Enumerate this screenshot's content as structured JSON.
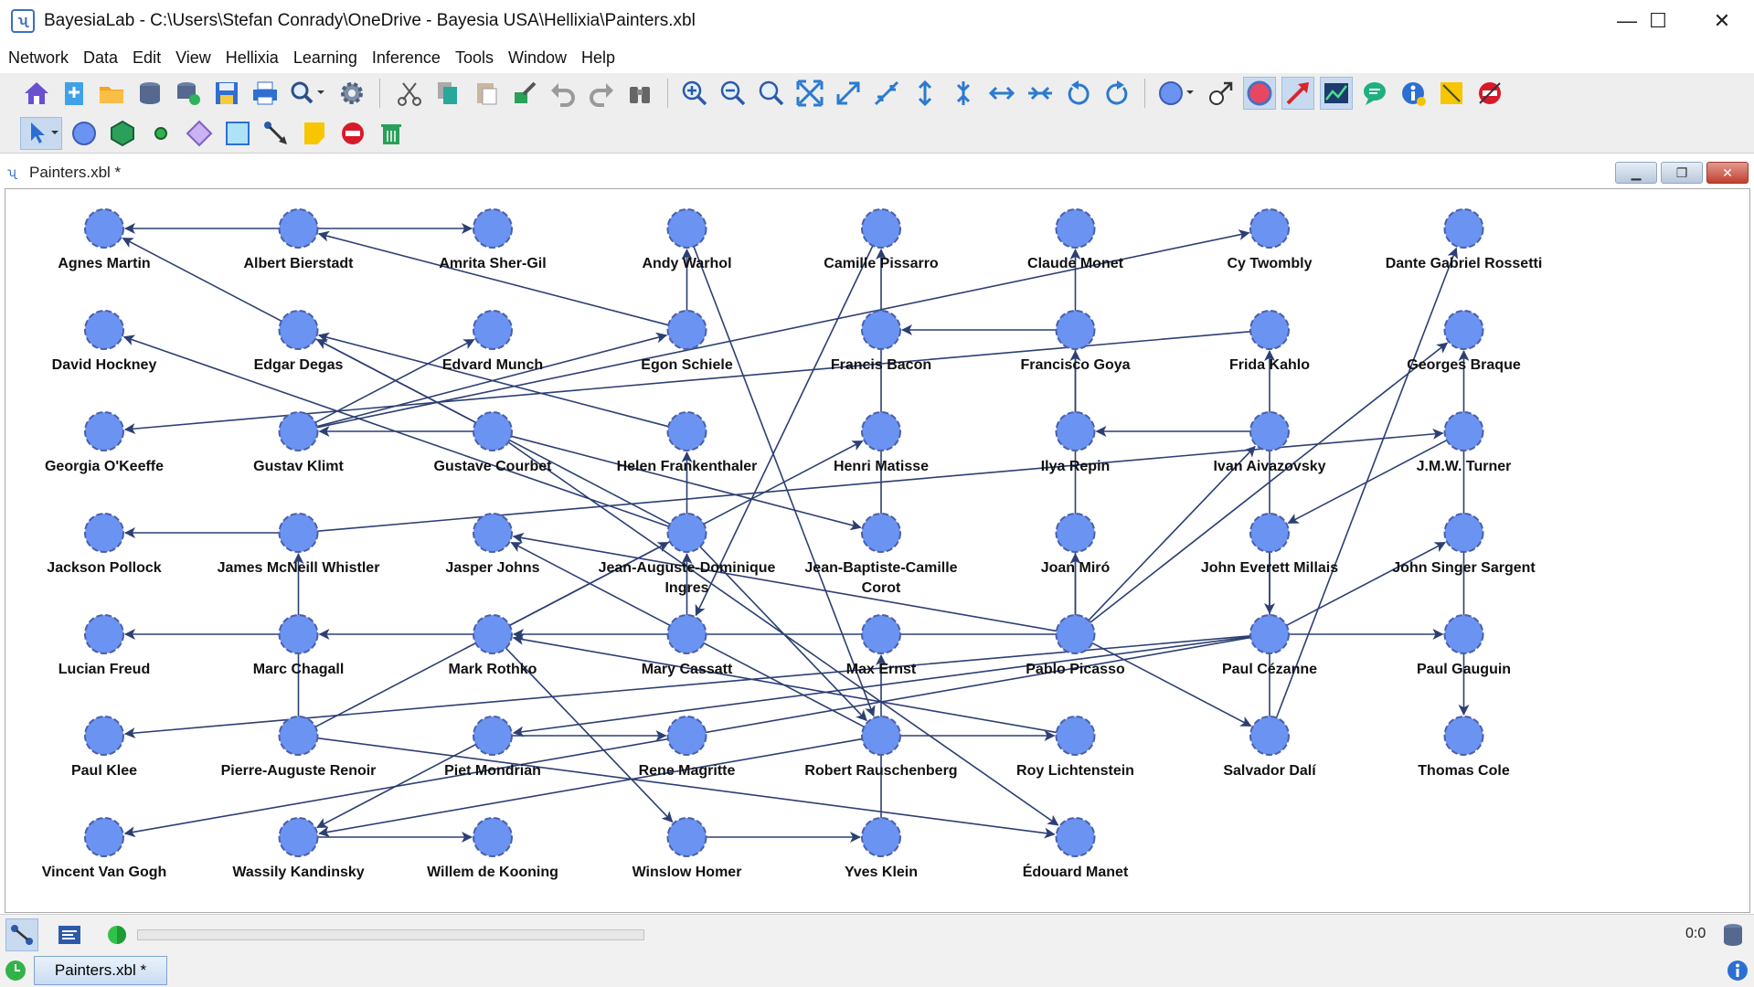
{
  "window": {
    "title": "BayesiaLab - C:\\Users\\Stefan Conrady\\OneDrive - Bayesia USA\\Hellixia\\Painters.xbl",
    "minimize": "—",
    "maximize": "☐",
    "close": "✕"
  },
  "menu": [
    "Network",
    "Data",
    "Edit",
    "View",
    "Hellixia",
    "Learning",
    "Inference",
    "Tools",
    "Window",
    "Help"
  ],
  "toolbar1_icons": [
    "home-icon",
    "new-network-icon",
    "open-folder-icon",
    "database-icon",
    "database-refresh-icon",
    "save-icon",
    "print-icon",
    "search-icon",
    "settings-icon",
    "cut-icon",
    "copy-icon",
    "paste-icon",
    "format-painter-icon",
    "undo-icon",
    "redo-icon",
    "binoculars-icon",
    "zoom-in-icon",
    "zoom-out-icon",
    "zoom-fit-icon",
    "expand-icon",
    "expand-diagonal-icon",
    "shrink-diagonal-icon",
    "expand-vertical-icon",
    "shrink-vertical-icon",
    "expand-horizontal-icon",
    "shrink-horizontal-icon",
    "rotate-left-icon",
    "rotate-right-icon",
    "node-style-icon",
    "layout-arrow-icon",
    "node-mode-icon",
    "arc-mode-icon",
    "chart-icon",
    "comment-icon",
    "info-icon",
    "note-icon",
    "forbidden-icon"
  ],
  "toolbar2_icons": [
    "select-arrow-icon",
    "add-node-icon",
    "add-hexagon-icon",
    "add-point-icon",
    "add-diamond-icon",
    "add-square-icon",
    "add-arc-icon",
    "add-note-icon",
    "forbid-arc-icon",
    "delete-icon"
  ],
  "document": {
    "title": "Painters.xbl *",
    "minimize": "▁",
    "restore": "❐",
    "close": "✕"
  },
  "status": {
    "zoom_readout": "0:0"
  },
  "tab": {
    "label": "Painters.xbl *"
  },
  "colors": {
    "node_fill": "#6b93f2",
    "node_stroke": "#4a5fa8",
    "edge": "#2c3f73"
  },
  "graph": {
    "nodes": [
      "Agnes Martin",
      "Albert Bierstadt",
      "Amrita Sher-Gil",
      "Andy Warhol",
      "Camille Pissarro",
      "Claude Monet",
      "Cy Twombly",
      "Dante Gabriel Rossetti",
      "David Hockney",
      "Edgar Degas",
      "Edvard Munch",
      "Egon Schiele",
      "Francis Bacon",
      "Francisco Goya",
      "Frida Kahlo",
      "Georges Braque",
      "Georgia O'Keeffe",
      "Gustav Klimt",
      "Gustave Courbet",
      "Helen Frankenthaler",
      "Henri Matisse",
      "Ilya Repin",
      "Ivan Aivazovsky",
      "J.M.W. Turner",
      "Jackson Pollock",
      "James McNeill Whistler",
      "Jasper Johns",
      "Jean-Auguste-Dominique Ingres",
      "Jean-Baptiste-Camille Corot",
      "Joan Miró",
      "John Everett Millais",
      "John Singer Sargent",
      "Lucian Freud",
      "Marc Chagall",
      "Mark Rothko",
      "Mary Cassatt",
      "Max Ernst",
      "Pablo Picasso",
      "Paul Cézanne",
      "Paul Gauguin",
      "Paul Klee",
      "Pierre-Auguste Renoir",
      "Piet Mondrian",
      "Rene Magritte",
      "Robert Rauschenberg",
      "Roy Lichtenstein",
      "Salvador Dalí",
      "Thomas Cole",
      "Vincent Van Gogh",
      "Wassily Kandinsky",
      "Willem de Kooning",
      "Winslow Homer",
      "Yves Klein",
      "Édouard Manet"
    ],
    "edges": [
      [
        "Albert Bierstadt",
        "Agnes Martin"
      ],
      [
        "Albert Bierstadt",
        "Amrita Sher-Gil"
      ],
      [
        "Egon Schiele",
        "Albert Bierstadt"
      ],
      [
        "Gustave Courbet",
        "Agnes Martin"
      ],
      [
        "Egon Schiele",
        "Andy Warhol"
      ],
      [
        "Jean-Baptiste-Camille Corot",
        "Camille Pissarro"
      ],
      [
        "Ilya Repin",
        "Claude Monet"
      ],
      [
        "Gustav Klimt",
        "Cy Twombly"
      ],
      [
        "Salvador Dalí",
        "Dante Gabriel Rossetti"
      ],
      [
        "Helen Frankenthaler",
        "Edgar Degas"
      ],
      [
        "Jean-Auguste-Dominique Ingres",
        "David Hockney"
      ],
      [
        "Gustav Klimt",
        "Edvard Munch"
      ],
      [
        "Gustav Klimt",
        "Egon Schiele"
      ],
      [
        "Francisco Goya",
        "Francis Bacon"
      ],
      [
        "Frida Kahlo",
        "Georgia O'Keeffe"
      ],
      [
        "Gustave Courbet",
        "Gustav Klimt"
      ],
      [
        "J.M.W. Turner",
        "Georges Braque"
      ],
      [
        "Ivan Aivazovsky",
        "Ilya Repin"
      ],
      [
        "Gustave Courbet",
        "Jean-Baptiste-Camille Corot"
      ],
      [
        "James McNeill Whistler",
        "Jackson Pollock"
      ],
      [
        "James McNeill Whistler",
        "J.M.W. Turner"
      ],
      [
        "Jean-Auguste-Dominique Ingres",
        "Helen Frankenthaler"
      ],
      [
        "Mark Rothko",
        "Henri Matisse"
      ],
      [
        "Jean-Auguste-Dominique Ingres",
        "Edgar Degas"
      ],
      [
        "Pablo Picasso",
        "Joan Miró"
      ],
      [
        "Pablo Picasso",
        "Francisco Goya"
      ],
      [
        "Pablo Picasso",
        "Ivan Aivazovsky"
      ],
      [
        "J.M.W. Turner",
        "John Everett Millais"
      ],
      [
        "Pablo Picasso",
        "Georges Braque"
      ],
      [
        "Pablo Picasso",
        "Jasper Johns"
      ],
      [
        "Marc Chagall",
        "Lucian Freud"
      ],
      [
        "Mark Rothko",
        "Marc Chagall"
      ],
      [
        "Pablo Picasso",
        "Mark Rothko"
      ],
      [
        "Camille Pissarro",
        "Mary Cassatt"
      ],
      [
        "Yves Klein",
        "Max Ernst"
      ],
      [
        "Paul Cézanne",
        "Paul Gauguin"
      ],
      [
        "John Everett Millais",
        "Paul Cézanne"
      ],
      [
        "Paul Cézanne",
        "John Singer Sargent"
      ],
      [
        "Paul Cézanne",
        "Paul Klee"
      ],
      [
        "Pierre-Auguste Renoir",
        "James McNeill Whistler"
      ],
      [
        "Paul Cézanne",
        "Piet Mondrian"
      ],
      [
        "Piet Mondrian",
        "Rene Magritte"
      ],
      [
        "Andy Warhol",
        "Robert Rauschenberg"
      ],
      [
        "Robert Rauschenberg",
        "Roy Lichtenstein"
      ],
      [
        "Pablo Picasso",
        "Salvador Dalí"
      ],
      [
        "J.M.W. Turner",
        "Thomas Cole"
      ],
      [
        "Paul Cézanne",
        "Vincent Van Gogh"
      ],
      [
        "Piet Mondrian",
        "Wassily Kandinsky"
      ],
      [
        "Wassily Kandinsky",
        "Willem de Kooning"
      ],
      [
        "Mark Rothko",
        "Winslow Homer"
      ],
      [
        "Winslow Homer",
        "Yves Klein"
      ],
      [
        "Pierre-Auguste Renoir",
        "Édouard Manet"
      ],
      [
        "Gustave Courbet",
        "Édouard Manet"
      ],
      [
        "Jean-Auguste-Dominique Ingres",
        "Robert Rauschenberg"
      ],
      [
        "Pierre-Auguste Renoir",
        "Jean-Auguste-Dominique Ingres"
      ],
      [
        "Robert Rauschenberg",
        "Wassily Kandinsky"
      ],
      [
        "Mary Cassatt",
        "Jean-Auguste-Dominique Ingres"
      ],
      [
        "Roy Lichtenstein",
        "Mark Rothko"
      ],
      [
        "Robert Rauschenberg",
        "Jasper Johns"
      ],
      [
        "Salvador Dalí",
        "Frida Kahlo"
      ]
    ]
  }
}
